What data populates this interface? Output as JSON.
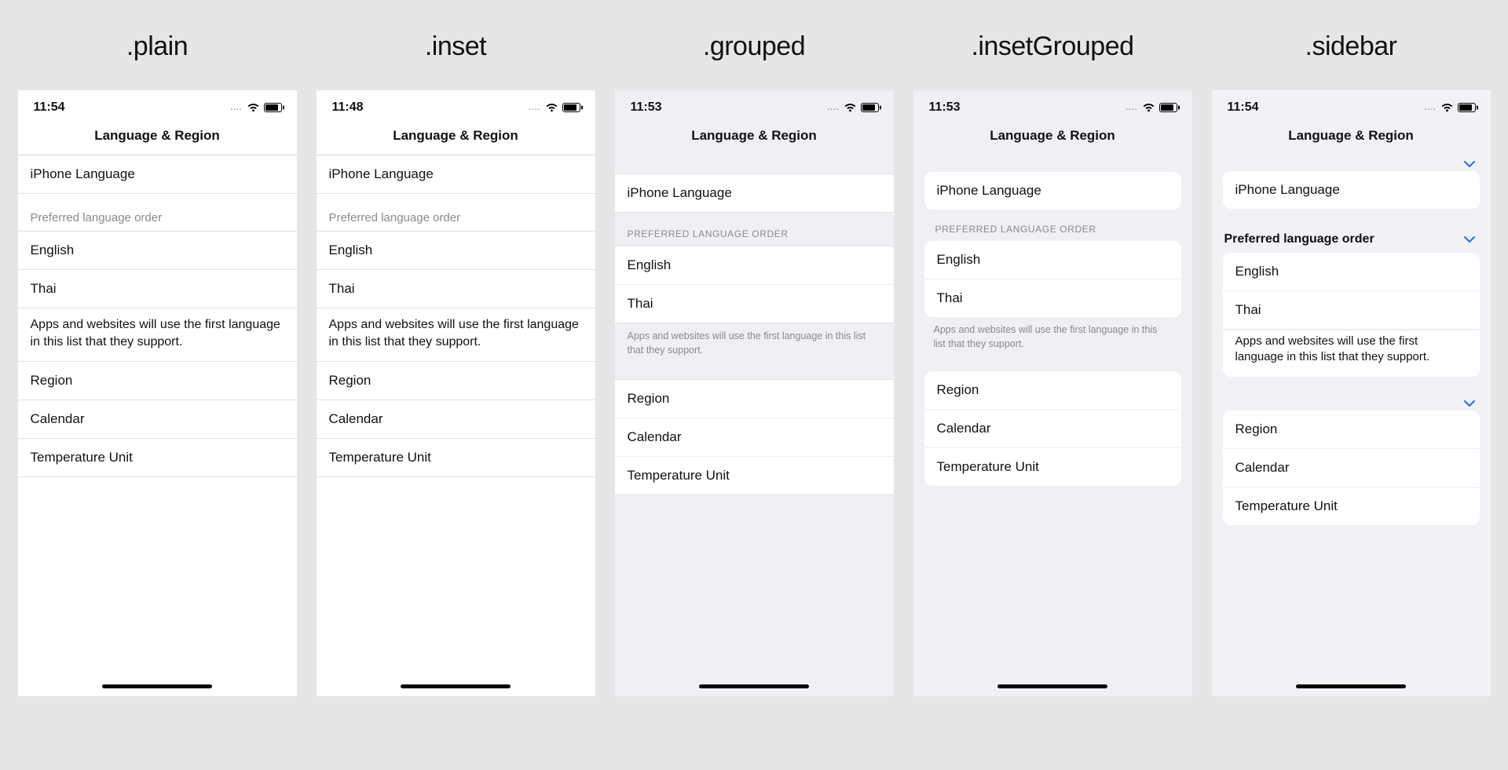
{
  "styles": {
    "plain": ".plain",
    "inset": ".inset",
    "grouped": ".grouped",
    "insetGrouped": ".insetGrouped",
    "sidebar": ".sidebar"
  },
  "times": {
    "plain": "11:54",
    "inset": "11:48",
    "grouped": "11:53",
    "insetGrouped": "11:53",
    "sidebar": "11:54"
  },
  "nav_title": "Language & Region",
  "rows": {
    "iphone_language": "iPhone Language",
    "english": "English",
    "thai": "Thai",
    "region": "Region",
    "calendar": "Calendar",
    "temp_unit": "Temperature Unit"
  },
  "headers": {
    "preferred_plain": "Preferred language order",
    "preferred_caps": "PREFERRED LANGUAGE ORDER",
    "preferred_sidebar": "Preferred language order"
  },
  "footer_text": "Apps and websites will use the first language in this list that they support."
}
